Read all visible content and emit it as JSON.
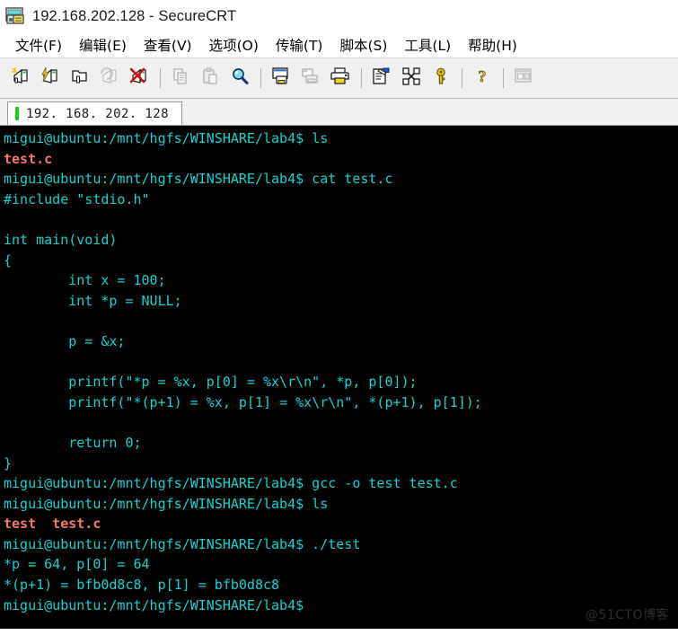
{
  "window": {
    "title": "192.168.202.128 - SecureCRT",
    "icon": "securecrt-app-icon"
  },
  "menubar": {
    "items": [
      {
        "label": "文件(F)",
        "name": "menu-file"
      },
      {
        "label": "编辑(E)",
        "name": "menu-edit"
      },
      {
        "label": "查看(V)",
        "name": "menu-view"
      },
      {
        "label": "选项(O)",
        "name": "menu-options"
      },
      {
        "label": "传输(T)",
        "name": "menu-transfer"
      },
      {
        "label": "脚本(S)",
        "name": "menu-script"
      },
      {
        "label": "工具(L)",
        "name": "menu-tools"
      },
      {
        "label": "帮助(H)",
        "name": "menu-help"
      }
    ]
  },
  "toolbar": {
    "buttons": [
      {
        "icon": "connect-icon",
        "name": "toolbar-connect",
        "enabled": true
      },
      {
        "icon": "quick-connect-icon",
        "name": "toolbar-quick-connect",
        "enabled": true
      },
      {
        "icon": "connect-in-tab-icon",
        "name": "toolbar-connect-in-tab",
        "enabled": true
      },
      {
        "icon": "reconnect-icon",
        "name": "toolbar-reconnect",
        "enabled": false
      },
      {
        "icon": "disconnect-icon",
        "name": "toolbar-disconnect",
        "enabled": true
      },
      {
        "separator": true
      },
      {
        "icon": "copy-icon",
        "name": "toolbar-copy",
        "enabled": false
      },
      {
        "icon": "paste-icon",
        "name": "toolbar-paste",
        "enabled": false
      },
      {
        "icon": "find-icon",
        "name": "toolbar-find",
        "enabled": true
      },
      {
        "separator": true
      },
      {
        "icon": "print-screen-icon",
        "name": "toolbar-print-screen",
        "enabled": true
      },
      {
        "icon": "log-session-icon",
        "name": "toolbar-log-session",
        "enabled": false
      },
      {
        "icon": "print-icon",
        "name": "toolbar-print",
        "enabled": true
      },
      {
        "separator": true
      },
      {
        "icon": "session-options-icon",
        "name": "toolbar-session-options",
        "enabled": true
      },
      {
        "icon": "global-options-icon",
        "name": "toolbar-global-options",
        "enabled": true
      },
      {
        "icon": "key-icon",
        "name": "toolbar-key-manager",
        "enabled": true
      },
      {
        "separator": true
      },
      {
        "icon": "help-icon",
        "name": "toolbar-help",
        "enabled": true
      },
      {
        "separator": true
      },
      {
        "icon": "arrange-windows-icon",
        "name": "toolbar-arrange-windows",
        "enabled": false
      }
    ]
  },
  "tabs": [
    {
      "label": "192. 168. 202. 128",
      "active": true,
      "led_color": "#16d016"
    }
  ],
  "terminal": {
    "background": "#000000",
    "foreground": "#14d2d2",
    "filename_color": "#f4796b",
    "lines": [
      {
        "text": "migui@ubuntu:/mnt/hgfs/WINSHARE/lab4$ ls",
        "style": "normal"
      },
      {
        "text": "test.c",
        "style": "filename"
      },
      {
        "text": "migui@ubuntu:/mnt/hgfs/WINSHARE/lab4$ cat test.c",
        "style": "normal"
      },
      {
        "text": "#include \"stdio.h\"",
        "style": "normal"
      },
      {
        "text": "",
        "style": "normal"
      },
      {
        "text": "int main(void)",
        "style": "normal"
      },
      {
        "text": "{",
        "style": "normal"
      },
      {
        "text": "        int x = 100;",
        "style": "normal"
      },
      {
        "text": "        int *p = NULL;",
        "style": "normal"
      },
      {
        "text": "",
        "style": "normal"
      },
      {
        "text": "        p = &x;",
        "style": "normal"
      },
      {
        "text": "",
        "style": "normal"
      },
      {
        "text": "        printf(\"*p = %x, p[0] = %x\\r\\n\", *p, p[0]);",
        "style": "normal"
      },
      {
        "text": "        printf(\"*(p+1) = %x, p[1] = %x\\r\\n\", *(p+1), p[1]);",
        "style": "normal"
      },
      {
        "text": "",
        "style": "normal"
      },
      {
        "text": "        return 0;",
        "style": "normal"
      },
      {
        "text": "}",
        "style": "normal"
      },
      {
        "text": "migui@ubuntu:/mnt/hgfs/WINSHARE/lab4$ gcc -o test test.c",
        "style": "normal"
      },
      {
        "text": "migui@ubuntu:/mnt/hgfs/WINSHARE/lab4$ ls",
        "style": "normal"
      },
      {
        "text": "test  test.c",
        "style": "filename"
      },
      {
        "text": "migui@ubuntu:/mnt/hgfs/WINSHARE/lab4$ ./test",
        "style": "normal"
      },
      {
        "text": "*p = 64, p[0] = 64",
        "style": "normal"
      },
      {
        "text": "*(p+1) = bfb0d8c8, p[1] = bfb0d8c8",
        "style": "normal"
      },
      {
        "text": "migui@ubuntu:/mnt/hgfs/WINSHARE/lab4$",
        "style": "normal"
      }
    ]
  },
  "watermark": {
    "text": "@51CTO博客"
  }
}
